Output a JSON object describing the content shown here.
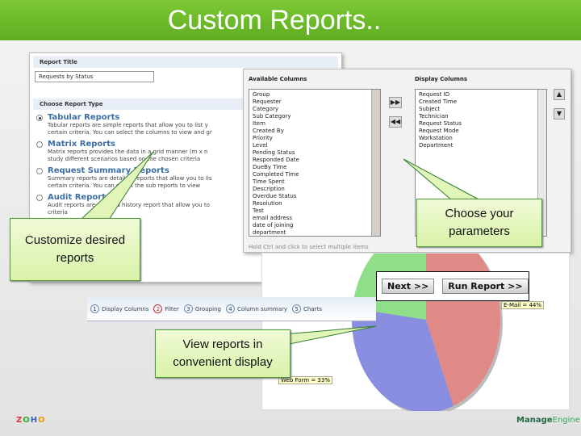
{
  "slide": {
    "title": "Custom Reports.."
  },
  "report_form": {
    "report_title_label": "Report Title",
    "report_title_value": "Requests by Status",
    "choose_type_label": "Choose Report Type",
    "types": [
      {
        "title": "Tabular Reports",
        "desc1": "Tabular reports are simple reports that allow you to list y",
        "desc2": "certain criteria. You can select the columns to view and gr",
        "selected": true
      },
      {
        "title": "Matrix Reports",
        "desc1": "Matrix reports provides the data in a grid manner (m x n",
        "desc2": "study different scenarios based on the chosen criteria",
        "selected": false
      },
      {
        "title": "Request Summary Reports",
        "desc1": "Summary reports are detailed reports that allow you to lis",
        "desc2": "certain criteria. You can select the sub reports to view",
        "selected": false
      },
      {
        "title": "Audit Reports",
        "desc1": "Audit reports are detailed history report that allow you to",
        "desc2": "criteria",
        "selected": false
      }
    ]
  },
  "columns": {
    "available_label": "Available Columns",
    "display_label": "Display Columns",
    "available": [
      "Group",
      "Requester",
      "Category",
      "Sub Category",
      "Item",
      "Created By",
      "Priority",
      "Level",
      "Pending Status",
      "Responded Date",
      "DueBy Time",
      "Completed Time",
      "Time Spent",
      "Description",
      "Overdue Status",
      "Resolution",
      "Test",
      "email address",
      "date of joining",
      "department"
    ],
    "display": [
      "Request ID",
      "Created Time",
      "Subject",
      "Technician",
      "Request Status",
      "Request Mode",
      "Workstation",
      "Department"
    ],
    "hint": "Hold Ctrl and click to select multiple items",
    "add_icon": "double-right-arrow",
    "remove_icon": "double-left-arrow",
    "up_icon": "up-arrow",
    "down_icon": "down-arrow"
  },
  "steps": [
    {
      "n": "1",
      "label": "Display Columns"
    },
    {
      "n": "2",
      "label": "Filter",
      "active": true
    },
    {
      "n": "3",
      "label": "Grouping"
    },
    {
      "n": "4",
      "label": "Column summary"
    },
    {
      "n": "5",
      "label": "Charts"
    }
  ],
  "buttons": {
    "next": "Next >>",
    "run": "Run Report >>"
  },
  "chart_data": {
    "type": "pie",
    "slices": [
      {
        "label": "E-Mail = 44%",
        "value": 44,
        "color": "#e08a88"
      },
      {
        "label": "Web Form = 33%",
        "value": 33,
        "color": "#8a8ee0"
      },
      {
        "label": "",
        "value": 23,
        "color": "#8ede8a"
      }
    ]
  },
  "callouts": {
    "customize": "Customize desired reports",
    "choose": "Choose your parameters",
    "view": "View reports in convenient display"
  },
  "footer": {
    "left_logo": "ZOHO",
    "right_logo": "ManageEngine"
  },
  "colors": {
    "header": "#6fbf2e",
    "callout": "#d9f2a8"
  }
}
